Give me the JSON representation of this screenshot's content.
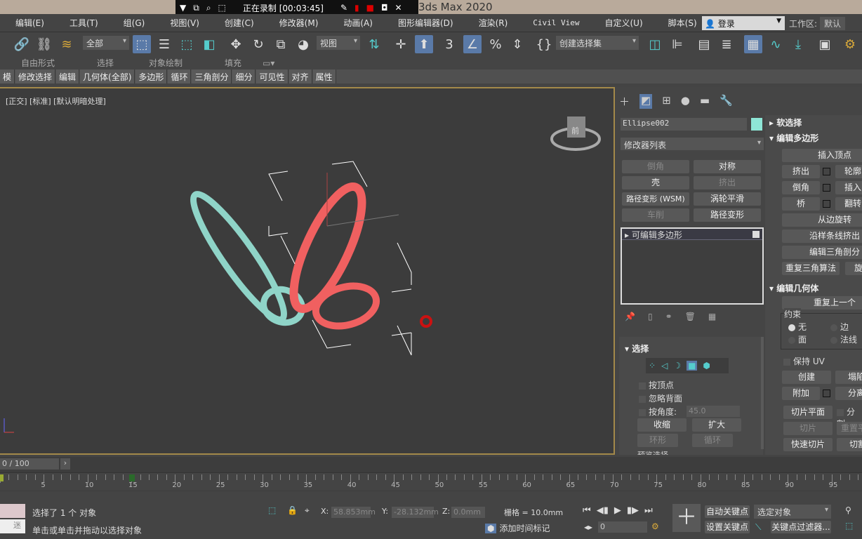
{
  "title": "3ds Max 2020",
  "recorder": {
    "status": "正在录制 [00:03:45]"
  },
  "menu": [
    "编辑(E)",
    "工具(T)",
    "组(G)",
    "视图(V)",
    "创建(C)",
    "修改器(M)",
    "动画(A)",
    "图形编辑器(D)",
    "渲染(R)",
    "Civil View",
    "自定义(U)",
    "脚本(S)"
  ],
  "login": "登录",
  "workspace": {
    "label": "工作区:",
    "value": "默认"
  },
  "toolbar": {
    "filter": "全部",
    "coord": "视图",
    "selection_set": "创建选择集"
  },
  "ribbon_tabs": [
    "自由形式",
    "选择",
    "对象绘制",
    "填充"
  ],
  "subribbon": [
    "模",
    "修改选择",
    "编辑",
    "几何体(全部)",
    "多边形",
    "循环",
    "三角剖分",
    "细分",
    "可见性",
    "对齐",
    "属性"
  ],
  "viewport": {
    "label": "[正交] [标准] [默认明暗处理]",
    "viewcube": "前"
  },
  "panel": {
    "object_name": "Ellipse002",
    "object_color": "#8ee6d6",
    "modifier_list": "修改器列表",
    "mod_buttons": [
      {
        "label": "倒角",
        "enabled": false
      },
      {
        "label": "对称",
        "enabled": true
      },
      {
        "label": "壳",
        "enabled": true
      },
      {
        "label": "挤出",
        "enabled": false
      },
      {
        "label": "路径变形 (WSM)",
        "enabled": true
      },
      {
        "label": "涡轮平滑",
        "enabled": true
      },
      {
        "label": "车削",
        "enabled": false
      },
      {
        "label": "路径变形",
        "enabled": true
      }
    ],
    "stack_item": "可编辑多边形",
    "selection": {
      "title": "选择",
      "by_vertex": "按顶点",
      "ignore_backfacing": "忽略背面",
      "by_angle": "按角度:",
      "angle": "45.0",
      "shrink": "收缩",
      "grow": "扩大",
      "ring": "环形",
      "loop": "循环",
      "preview": "预览选择"
    },
    "soft_selection": "软选择",
    "edit_poly": {
      "title": "编辑多边形",
      "insert_vertex": "插入顶点",
      "extrude": "挤出",
      "outline": "轮廓",
      "bevel": "倒角",
      "inset": "插入",
      "bridge": "桥",
      "flip": "翻转",
      "hinge": "从边旋转",
      "extrude_spline": "沿样条线挤出",
      "edit_tri": "编辑三角剖分",
      "retriangulate": "重复三角算法",
      "turn": "旋转"
    },
    "edit_geom": {
      "title": "编辑几何体",
      "repeat": "重复上一个",
      "constraints": "约束",
      "none": "无",
      "edge": "边",
      "face": "面",
      "normal": "法线",
      "preserve_uv": "保持 UV",
      "create": "创建",
      "collapse": "塌陷",
      "attach": "附加",
      "detach": "分离",
      "slice_plane": "切片平面",
      "split": "分割",
      "slice": "切片",
      "reset_plane": "重置平面",
      "quickslice": "快速切片",
      "cut": "切割"
    }
  },
  "timeline": {
    "frame": "0 / 100",
    "ticks": [
      "5",
      "10",
      "15",
      "20",
      "25",
      "30",
      "35",
      "40",
      "45",
      "50",
      "55",
      "60",
      "65",
      "70",
      "75",
      "80",
      "85",
      "90",
      "95"
    ]
  },
  "status": {
    "selected": "选择了 1 个 对象",
    "prompt": "单击或单击并拖动以选择对象",
    "x": "58.853mm",
    "y": "-28.132mm",
    "z": "0.0mm",
    "grid": "栅格 = 10.0mm",
    "add_time_tag": "添加时间标记",
    "frame_field": "0",
    "auto_key": "自动关键点",
    "set_key": "设置关键点",
    "key_mode": "选定对象",
    "key_filters": "关键点过滤器...",
    "maxscript": "迷"
  }
}
